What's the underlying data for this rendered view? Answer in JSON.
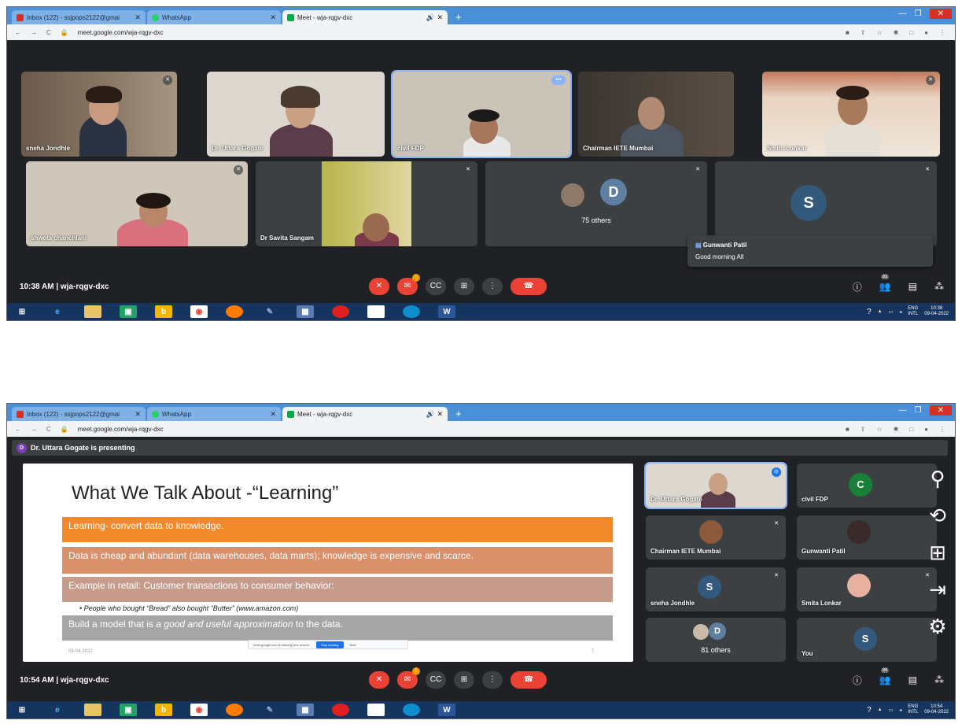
{
  "browser": {
    "tabs": [
      {
        "label": "Inbox (122) - ssjpops2122@gmai",
        "color": "#d93025"
      },
      {
        "label": "WhatsApp",
        "color": "#25d366"
      },
      {
        "label": "Meet - wja-rqgv-dxc",
        "color": "#00ac47"
      }
    ],
    "url": "meet.google.com/wja-rqgv-dxc"
  },
  "shot1": {
    "participants": [
      {
        "name": "sneha Jondhle"
      },
      {
        "name": "Dr. Uttara Gogate"
      },
      {
        "name": "civil FDP"
      },
      {
        "name": "Chairman IETE Mumbai"
      },
      {
        "name": "Smita Lonkar"
      },
      {
        "name": "shweta chanchlani"
      },
      {
        "name": "Dr Savita Sangam"
      }
    ],
    "others_avatar": "D",
    "others_label": "75 others",
    "s_avatar": "S",
    "chat": {
      "sender": "Gunwanti Patil",
      "message": "Good morning All"
    },
    "time": "10:38 AM",
    "meeting_code": "wja-rqgv-dxc",
    "people_count": "83",
    "tray_lang": "ENG",
    "tray_layout": "INTL",
    "tray_time": "10:38",
    "tray_date": "09-04-2022"
  },
  "shot2": {
    "presenting_avatar": "D",
    "presenting": "Dr. Uttara Gogate is presenting",
    "slide": {
      "title": "What We Talk About -“Learning”",
      "b1": "Learning- convert data to knowledge.",
      "b2": "Data is cheap and abundant (data warehouses, data marts); knowledge is expensive and scarce.",
      "b3": "Example in retail: Customer transactions to consumer behavior:",
      "bullet": "• People who bought “Bread” also bought “Butter” (www.amazon.com)",
      "b4_pre": "Build a model that is ",
      "b4_em": "a good and useful approximation",
      "b4_post": " to the data.",
      "date": "09-04-2022",
      "page": "7"
    },
    "share_text": "meet.google.com is sharing your screen.",
    "stop_sharing": "Stop sharing",
    "hide": "Hide",
    "tiles": [
      {
        "name": "Dr. Uttara Gogate"
      },
      {
        "name": "civil FDP",
        "avatar": "C"
      },
      {
        "name": "Chairman IETE Mumbai"
      },
      {
        "name": "Gunwanti Patil"
      },
      {
        "name": "sneha Jondhle",
        "avatar": "S"
      },
      {
        "name": "Smita Lonkar"
      },
      {
        "name": "81 others",
        "avatar": "D"
      },
      {
        "name": "You",
        "avatar": "S"
      }
    ],
    "time": "10:54 AM",
    "meeting_code": "wja-rqgv-dxc",
    "people_count": "89",
    "tray_lang": "ENG",
    "tray_layout": "INTL",
    "tray_time": "10:54",
    "tray_date": "09-04-2022"
  }
}
